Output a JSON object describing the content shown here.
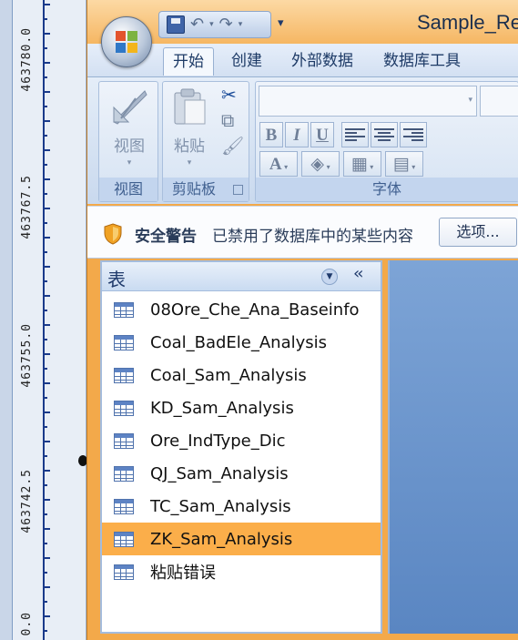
{
  "ruler": {
    "labels": [
      "463780.0",
      "463767.5",
      "463755.0",
      "463742.5",
      "0.0"
    ]
  },
  "window": {
    "title": "Sample_Re",
    "tabs": [
      "开始",
      "创建",
      "外部数据",
      "数据库工具"
    ],
    "active_tab": "开始"
  },
  "ribbon": {
    "view_group": {
      "button_label": "视图",
      "group_label": "视图"
    },
    "clipboard_group": {
      "button_label": "粘贴",
      "group_label": "剪贴板"
    },
    "font_group": {
      "group_label": "字体"
    }
  },
  "security_bar": {
    "title": "安全警告",
    "message": "已禁用了数据库中的某些内容",
    "options_button": "选项..."
  },
  "nav_pane": {
    "header": "表",
    "items": [
      "08Ore_Che_Ana_Baseinfo",
      "Coal_BadEle_Analysis",
      "Coal_Sam_Analysis",
      "KD_Sam_Analysis",
      "Ore_IndType_Dic",
      "QJ_Sam_Analysis",
      "TC_Sam_Analysis",
      "ZK_Sam_Analysis",
      "粘贴错误"
    ],
    "selected_item": "ZK_Sam_Analysis"
  },
  "colors": {
    "accent_orange": "#f3a94a",
    "selection": "#fbae4a",
    "ribbon_blue": "#c9d9ee"
  }
}
